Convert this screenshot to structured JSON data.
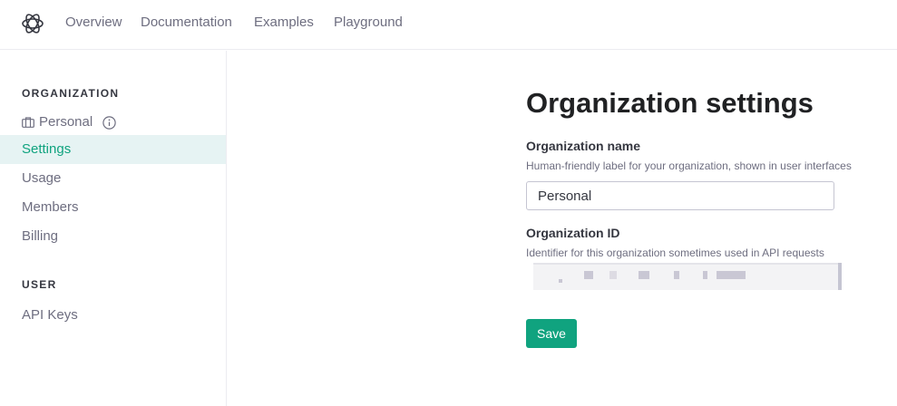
{
  "topnav": {
    "logo_icon": "openai-logo-icon",
    "links": [
      "Overview",
      "Documentation",
      "Examples",
      "Playground"
    ]
  },
  "sidebar": {
    "organization_title": "ORGANIZATION",
    "org_name": "Personal",
    "org_icon": "briefcase-icon",
    "info_icon": "info-icon",
    "items": [
      "Settings",
      "Usage",
      "Members",
      "Billing"
    ],
    "active_item": "Settings",
    "user_title": "USER",
    "user_items": [
      "API Keys"
    ]
  },
  "main": {
    "title": "Organization settings",
    "org_name_label": "Organization name",
    "org_name_help": "Human-friendly label for your organization, shown in user interfaces",
    "org_name_value": "Personal",
    "org_id_label": "Organization ID",
    "org_id_help": "Identifier for this organization sometimes used in API requests",
    "save_label": "Save"
  },
  "colors": {
    "accent": "#10a37f",
    "active_bg": "#e6f3f3",
    "text_primary": "#353740",
    "text_secondary": "#6e6e80",
    "border": "#ececf1"
  }
}
